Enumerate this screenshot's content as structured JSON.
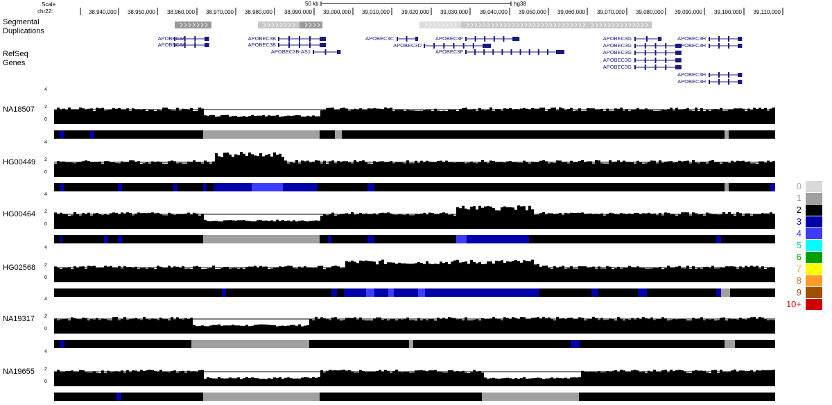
{
  "header": {
    "scale_label": "Scale",
    "chrom_label": "chr22:",
    "scale_bar_label": "50 kb",
    "assembly": "hg38",
    "ruler_ticks": [
      "38,940,000",
      "38,950,000",
      "38,960,000",
      "38,970,000",
      "38,980,000",
      "38,990,000",
      "39,000,000",
      "39,010,000",
      "39,020,000",
      "39,030,000",
      "39,040,000",
      "39,050,000",
      "39,060,000",
      "39,070,000",
      "39,080,000",
      "39,090,000",
      "39,100,000",
      "39,110,000"
    ]
  },
  "tracks": {
    "segdup_label_1": "Segmental",
    "segdup_label_2": "Duplications",
    "refseq_label_1": "RefSeq",
    "refseq_label_2": "Genes"
  },
  "genes": [
    {
      "label": "APOBEC3A"
    },
    {
      "label": "APOBEC3A"
    },
    {
      "label": "APOBEC3B"
    },
    {
      "label": "APOBEC3B"
    },
    {
      "label": "APOBEC3B-AS1"
    },
    {
      "label": "APOBEC3C"
    },
    {
      "label": "APOBEC3D"
    },
    {
      "label": "APOBEC3F"
    },
    {
      "label": "APOBEC3F"
    },
    {
      "label": "APOBEC3G"
    },
    {
      "label": "APOBEC3G"
    },
    {
      "label": "APOBEC3G"
    },
    {
      "label": "APOBEC3G"
    },
    {
      "label": "APOBEC3G"
    },
    {
      "label": "APOBEC3H"
    },
    {
      "label": "APOBEC3H"
    },
    {
      "label": "APOBEC3H"
    },
    {
      "label": "APOBEC3H"
    }
  ],
  "y_ticks": [
    "4",
    "2",
    "0"
  ],
  "samples": [
    {
      "name": "NA18507"
    },
    {
      "name": "HG00449"
    },
    {
      "name": "HG00464"
    },
    {
      "name": "HG02568"
    },
    {
      "name": "NA19317"
    },
    {
      "name": "NA19655"
    }
  ],
  "legend": [
    {
      "label": "0",
      "color": "#d9d9d9"
    },
    {
      "label": "1",
      "color": "#a0a0a0"
    },
    {
      "label": "2",
      "color": "#000000"
    },
    {
      "label": "3",
      "color": "#0000a8"
    },
    {
      "label": "4",
      "color": "#3c3cff"
    },
    {
      "label": "5",
      "color": "#00ffff"
    },
    {
      "label": "6",
      "color": "#00a000"
    },
    {
      "label": "7",
      "color": "#ffff00"
    },
    {
      "label": "8",
      "color": "#ff9a2a"
    },
    {
      "label": "9",
      "color": "#a05000"
    },
    {
      "label": "10+",
      "color": "#d00000"
    }
  ],
  "legend_text_colors": [
    "#aaaaaa",
    "#888888",
    "#000000",
    "#0000a8",
    "#3c3cff",
    "#00c0c0",
    "#00a000",
    "#c8b400",
    "#d07010",
    "#a05000",
    "#d00000"
  ]
}
